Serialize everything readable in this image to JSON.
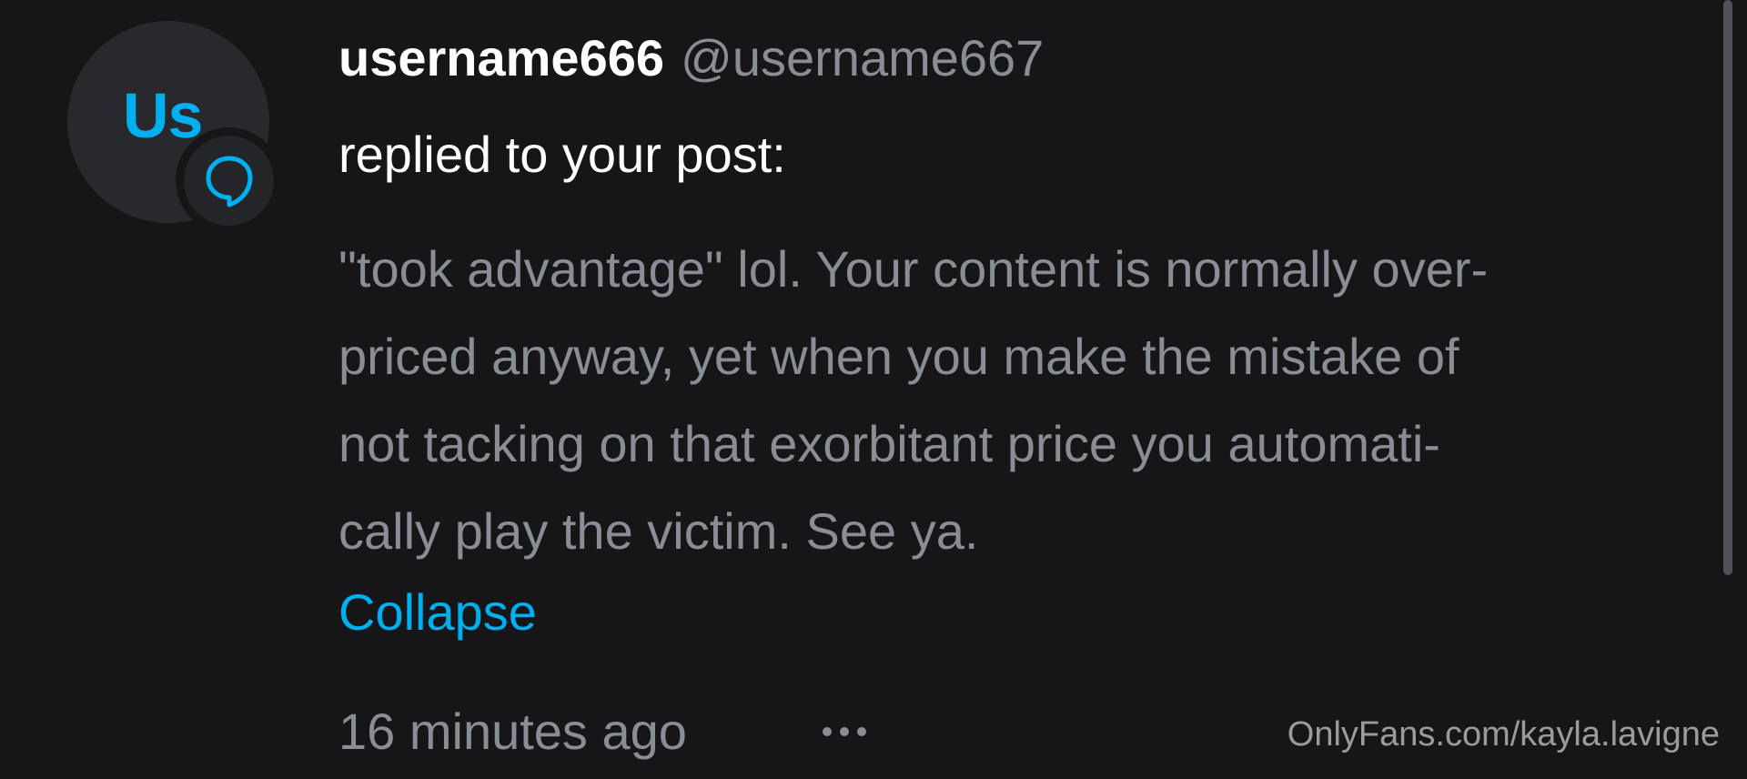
{
  "notification": {
    "avatar": {
      "initials": "Us",
      "badge_icon": "comment-bubble-icon"
    },
    "username": "username666",
    "handle": "@username667",
    "action": "replied to your post:",
    "message": "\"took advantage\" lol. Your content is normally over-\npriced anyway, yet when you make the mistake of\nnot tacking on that exorbitant price you automati-\ncally play the victim. See ya.",
    "collapse_label": "Collapse",
    "timestamp": "16 minutes ago",
    "more_icon": "more-options-icon"
  },
  "watermark": "OnlyFans.com/kayla.lavigne",
  "colors": {
    "background": "#161618",
    "accent": "#00aff0",
    "text_primary": "#ffffff",
    "text_secondary": "#8a8d93"
  }
}
